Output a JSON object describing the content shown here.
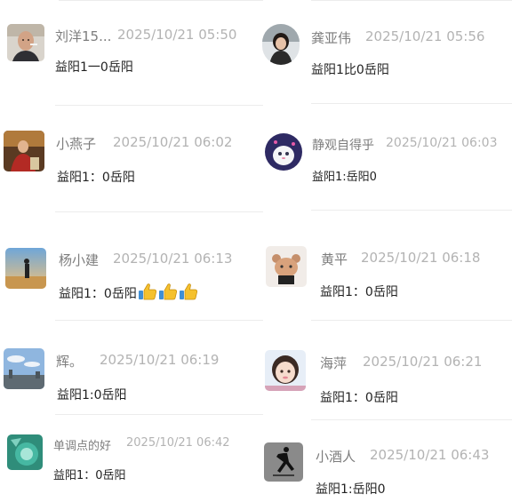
{
  "comments": [
    {
      "name": "刘洋15...",
      "time": "2025/10/21 05:50",
      "text": "益阳1一0岳阳",
      "avatar_icon": "bald-man-avatar-icon"
    },
    {
      "name": "龚亚伟",
      "time": "2025/10/21 05:56",
      "text": "益阳1比0岳阳",
      "avatar_icon": "girl-portrait-avatar-icon"
    },
    {
      "name": "小燕子",
      "time": "2025/10/21 06:02",
      "text": "益阳1：0岳阳",
      "avatar_icon": "costume-portrait-avatar-icon"
    },
    {
      "name": "静观自得乎",
      "time": "2025/10/21 06:03",
      "text": "益阳1:岳阳0",
      "avatar_icon": "cartoon-cat-avatar-icon"
    },
    {
      "name": "杨小建",
      "time": "2025/10/21 06:13",
      "text": "益阳1：0岳阳",
      "emoji_icon": "thumbs-up-icon",
      "emoji_count": 3,
      "avatar_icon": "sunset-silhouette-avatar-icon"
    },
    {
      "name": "黄平",
      "time": "2025/10/21 06:18",
      "text": "益阳1：0岳阳",
      "avatar_icon": "cartoon-bear-avatar-icon"
    },
    {
      "name": "辉。",
      "time": "2025/10/21 06:19",
      "text": "益阳1:0岳阳",
      "avatar_icon": "city-sky-avatar-icon"
    },
    {
      "name": "海萍",
      "time": "2025/10/21 06:21",
      "text": "益阳1：0岳阳",
      "avatar_icon": "girl-selfie-avatar-icon"
    },
    {
      "name": "单调点的好",
      "time": "2025/10/21 06:42",
      "text": "益阳1：0岳阳",
      "avatar_icon": "green-glass-avatar-icon"
    },
    {
      "name": "小酒人",
      "time": "2025/10/21 06:43",
      "text": "益阳1:岳阳0",
      "avatar_icon": "jumpman-logo-avatar-icon"
    }
  ],
  "colors": {
    "name": "#7d7d7d",
    "time": "#b3b3b3",
    "text": "#222222",
    "divider": "#ececec"
  }
}
